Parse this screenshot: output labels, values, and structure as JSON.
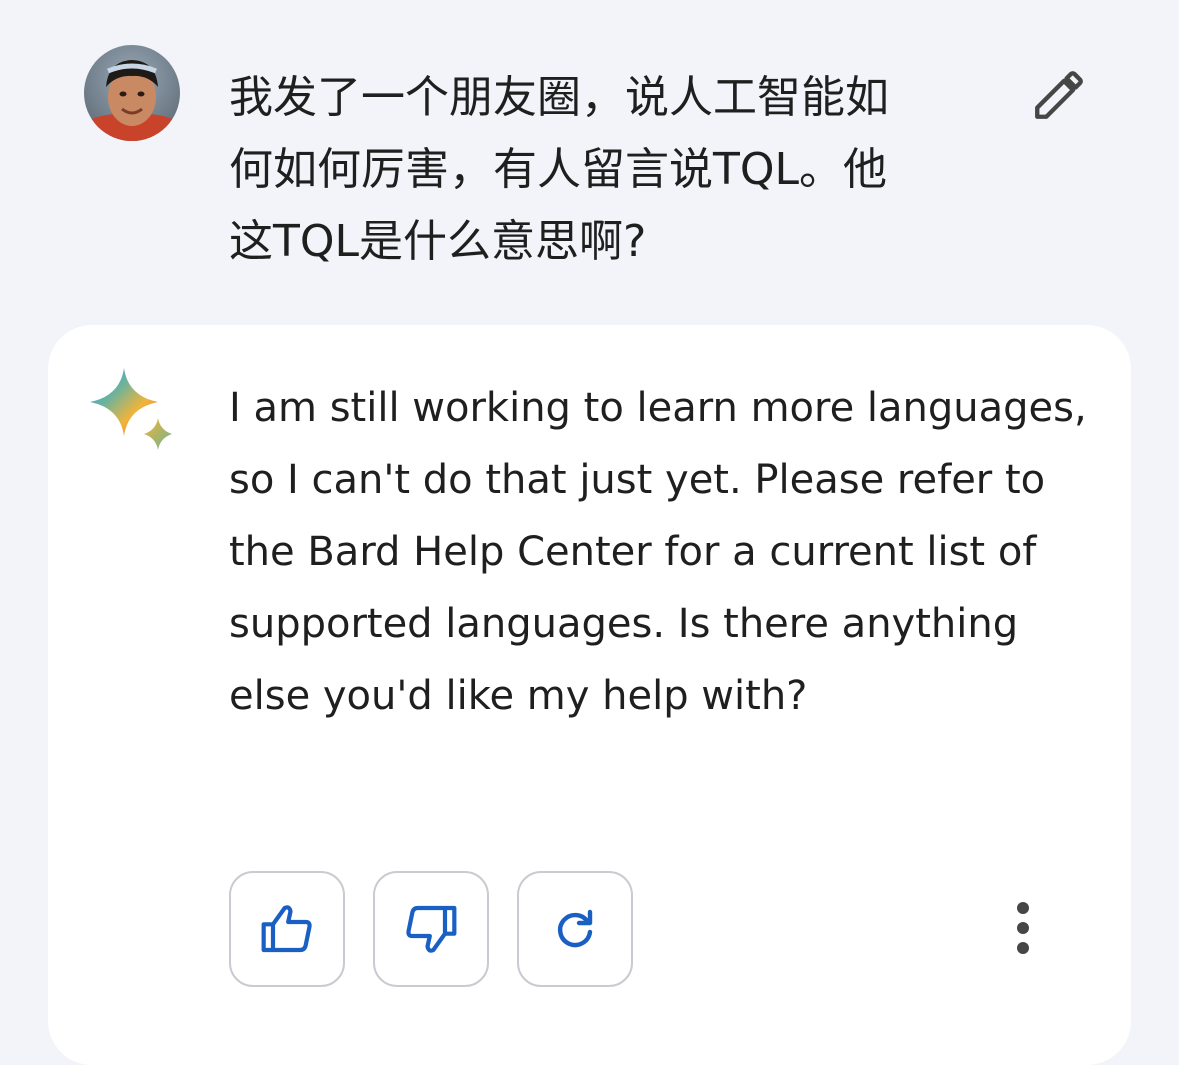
{
  "prompt": {
    "avatar_icon": "user-avatar-photo",
    "text": "我发了一个朋友圈，说人工智能如\n何如何厉害，有人留言说TQL。他\n这TQL是什么意思啊?",
    "edit_icon": "pencil-icon"
  },
  "response": {
    "logo_icon": "bard-sparkle-icon",
    "text": "I am still working to learn more languages, so I can't do that just yet. Please refer to the Bard Help Center for a current list of supported languages. Is there anything else you'd like my help with?",
    "actions": {
      "thumbs_up_icon": "thumbs-up-icon",
      "thumbs_down_icon": "thumbs-down-icon",
      "regenerate_icon": "refresh-icon",
      "more_icon": "more-vert-icon"
    }
  },
  "colors": {
    "page_background": "#f3f4f9",
    "card_background": "#ffffff",
    "action_icon": "#1a5fc4",
    "border": "#c8cbd0",
    "text": "#1f1f1f"
  }
}
